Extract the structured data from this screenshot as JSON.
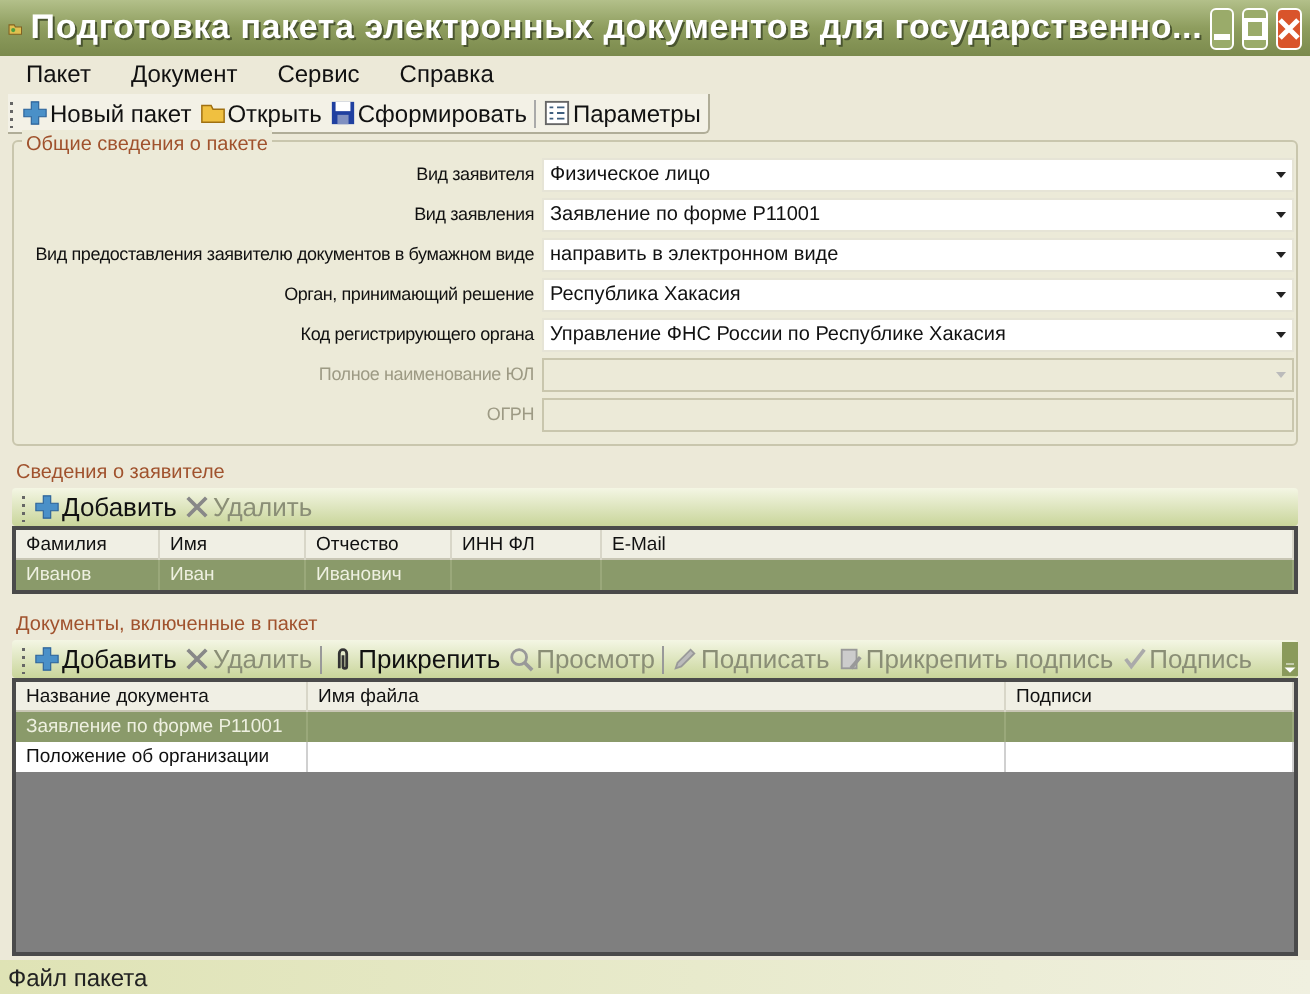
{
  "window": {
    "title": "Подготовка пакета электронных документов для государственно..."
  },
  "menu": [
    "Пакет",
    "Документ",
    "Сервис",
    "Справка"
  ],
  "toolbar": [
    {
      "label": "Новый пакет",
      "kind": "plus"
    },
    {
      "label": "Открыть",
      "kind": "folder"
    },
    {
      "label": "Сформировать",
      "kind": "save"
    },
    {
      "label": "Параметры",
      "kind": "params"
    }
  ],
  "general": {
    "title": "Общие сведения о пакете",
    "fields": [
      {
        "label": "Вид заявителя",
        "kind": "combo",
        "value": "Физическое лицо",
        "disabled": false
      },
      {
        "label": "Вид заявления",
        "kind": "combo",
        "value": "Заявление по форме Р11001",
        "disabled": false
      },
      {
        "label": "Вид предоставления заявителю документов в бумажном виде",
        "kind": "combo",
        "value": "направить в электронном виде",
        "disabled": false
      },
      {
        "label": "Орган, принимающий решение",
        "kind": "combo",
        "value": "Республика Хакасия",
        "disabled": false
      },
      {
        "label": "Код регистрирующего органа",
        "kind": "combo",
        "value": "Управление ФНС России по Республике Хакасия",
        "disabled": false
      },
      {
        "label": "Полное наименование ЮЛ",
        "kind": "combo",
        "disabled": true
      },
      {
        "label": "ОГРН",
        "kind": "text",
        "disabled": true
      }
    ]
  },
  "applicants": {
    "title": "Сведения о заявителе",
    "toolbar": [
      {
        "label": "Добавить",
        "kind": "plus",
        "disabled": false
      },
      {
        "label": "Удалить",
        "kind": "x",
        "disabled": true
      }
    ],
    "columns": [
      "Фамилия",
      "Имя",
      "Отчество",
      "ИНН ФЛ",
      "E-Mail"
    ],
    "rows": [
      {
        "cells": [
          "Иванов",
          "Иван",
          "Иванович",
          "",
          ""
        ],
        "selected": true
      }
    ]
  },
  "documents": {
    "title": "Документы, включенные в пакет",
    "toolbar": [
      {
        "label": "Добавить",
        "kind": "plus",
        "disabled": false
      },
      {
        "label": "Удалить",
        "kind": "x",
        "disabled": true
      },
      {
        "label": "Прикрепить",
        "kind": "clip",
        "disabled": false
      },
      {
        "label": "Просмотр",
        "kind": "view",
        "disabled": true
      },
      {
        "label": "Подписать",
        "kind": "pen",
        "disabled": true
      },
      {
        "label": "Прикрепить подпись",
        "kind": "seal",
        "disabled": true
      },
      {
        "label": "Подпись",
        "kind": "check",
        "disabled": true
      }
    ],
    "columns": [
      "Название документа",
      "Имя файла",
      "Подписи"
    ],
    "rows": [
      {
        "cells": [
          "Заявление по форме Р11001",
          "",
          ""
        ],
        "selected": true
      },
      {
        "cells": [
          "Положение об организации",
          "",
          ""
        ],
        "selected": false
      }
    ]
  },
  "status_bar": "Файл пакета"
}
